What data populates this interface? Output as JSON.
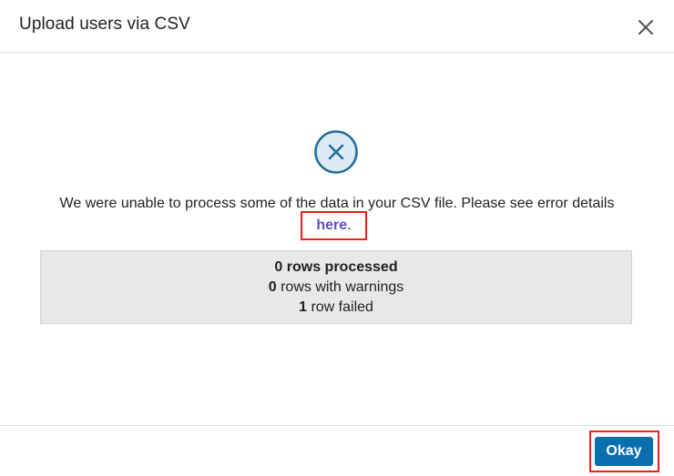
{
  "dialog": {
    "title": "Upload users via CSV",
    "close_icon": "close-icon"
  },
  "status": {
    "icon": "error-x-circle-icon",
    "icon_color": "#1f6e96",
    "icon_fill": "#dcebf3"
  },
  "message": {
    "text": "We were unable to process some of the data in your CSV file. Please see error details",
    "link_label": "here",
    "trailing": "."
  },
  "summary": {
    "processed_count": "0",
    "processed_label": "rows processed",
    "warnings_count": "0",
    "warnings_label": "rows with warnings",
    "failed_count": "1",
    "failed_label": "row failed"
  },
  "footer": {
    "okay_label": "Okay",
    "okay_color": "#0a6fae"
  },
  "highlight_color": "#e8221b"
}
